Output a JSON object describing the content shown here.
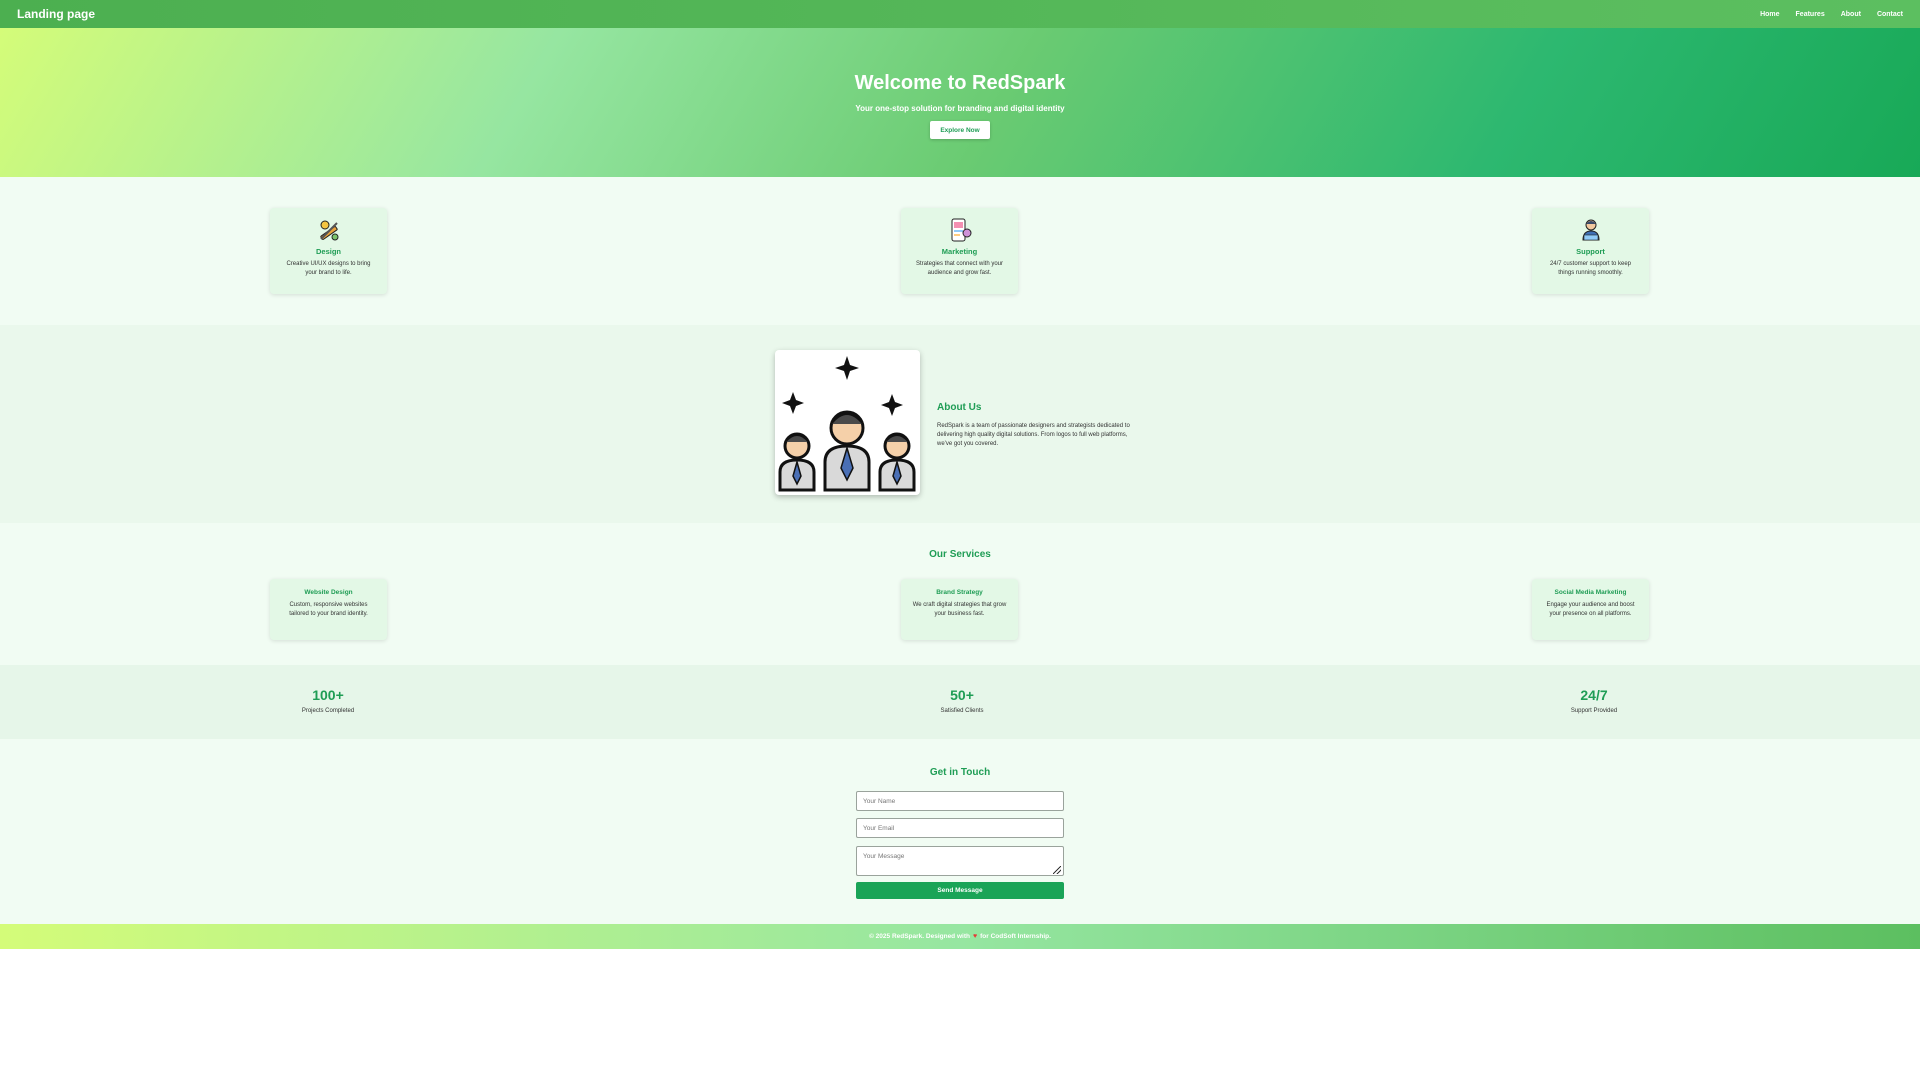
{
  "nav": {
    "brand": "Landing page",
    "links": [
      "Home",
      "Features",
      "About",
      "Contact"
    ]
  },
  "hero": {
    "title": "Welcome to RedSpark",
    "subtitle": "Your one-stop solution for branding and digital identity",
    "button": "Explore Now"
  },
  "features": [
    {
      "icon": "design-tools-icon",
      "title": "Design",
      "text": "Creative UI/UX designs to bring your brand to life."
    },
    {
      "icon": "marketing-phone-icon",
      "title": "Marketing",
      "text": "Strategies that connect with your audience and grow fast."
    },
    {
      "icon": "support-agent-icon",
      "title": "Support",
      "text": "24/7 customer support to keep things running smoothly."
    }
  ],
  "about": {
    "image": "team-illustration",
    "title": "About Us",
    "text": "RedSpark is a team of passionate designers and strategists dedicated to delivering high quality digital solutions. From logos to full web platforms, we've got you covered."
  },
  "services": {
    "title": "Our Services",
    "items": [
      {
        "title": "Website Design",
        "text": "Custom, responsive websites tailored to your brand identity."
      },
      {
        "title": "Brand Strategy",
        "text": "We craft digital strategies that grow your business fast."
      },
      {
        "title": "Social Media Marketing",
        "text": "Engage your audience and boost your presence on all platforms."
      }
    ]
  },
  "stats": [
    {
      "value": "100+",
      "label": "Projects Completed"
    },
    {
      "value": "50+",
      "label": "Satisfied Clients"
    },
    {
      "value": "24/7",
      "label": "Support Provided"
    }
  ],
  "contact": {
    "title": "Get in Touch",
    "name_placeholder": "Your Name",
    "email_placeholder": "Your Email",
    "message_placeholder": "Your Message",
    "button": "Send Message"
  },
  "footer": {
    "before": "© 2025 RedSpark. Designed with",
    "after": "for CodSoft Internship."
  },
  "colors": {
    "accent": "#1f9d55",
    "nav": "#4caf50",
    "footer_heart": "#e53935"
  }
}
